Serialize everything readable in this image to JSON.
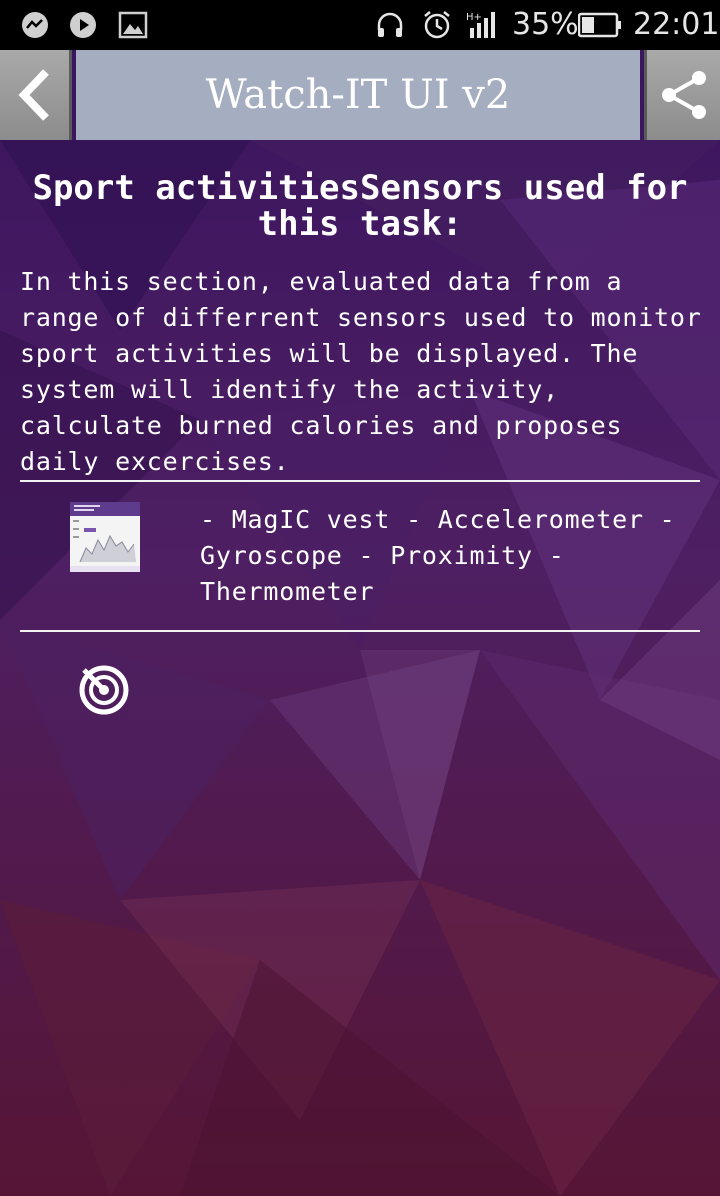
{
  "status_bar": {
    "icons": [
      "messenger-icon",
      "play-icon",
      "image-icon",
      "headset-icon",
      "alarm-icon",
      "hplus-signal-icon",
      "battery-icon"
    ],
    "network_label": "H+",
    "battery_percent": "35%",
    "time": "22:01"
  },
  "header": {
    "title": "Watch-IT UI v2",
    "back_icon": "chevron-left-icon",
    "share_icon": "share-icon"
  },
  "section": {
    "heading": "Sport activitiesSensors used for this task:",
    "description": "In this section, evaluated data from a range of differrent sensors used to monitor sport activities will be displayed. The system will identify the activity, calculate burned calories and proposes daily excercises.",
    "sensors_text": "- MagIC vest - Accelerometer - Gyroscope - Proximity - Thermometer",
    "thumbnail_icon": "activity-chart-thumbnail",
    "action_icon": "radar-icon"
  },
  "colors": {
    "background_top": "#3a1560",
    "background_bottom": "#5a1838",
    "header_panel": "#a5adc0",
    "header_buttons": "#9a9a9a",
    "text": "#ffffff"
  }
}
